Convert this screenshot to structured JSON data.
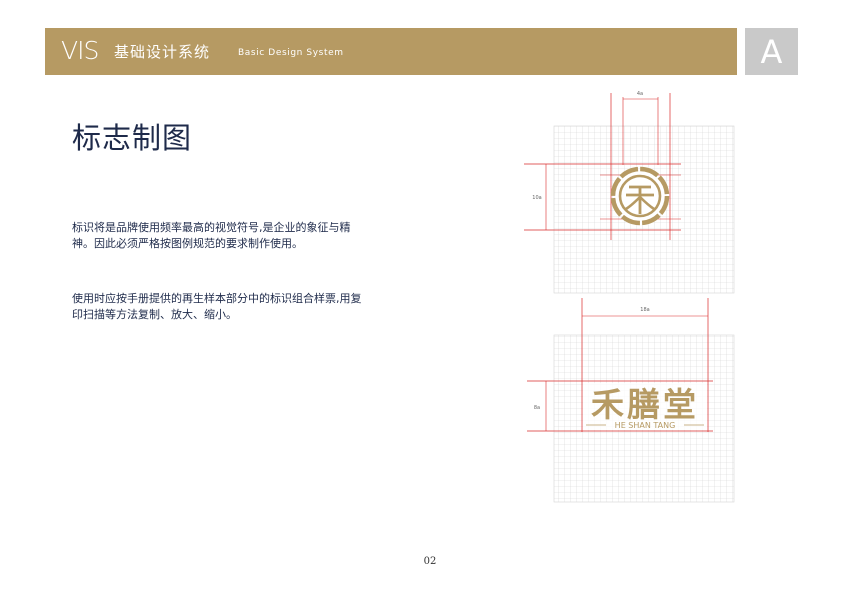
{
  "header": {
    "logo_text": "VIS",
    "title_cn": "基础设计系统",
    "title_en": "Basic Design System",
    "section_letter": "A",
    "bar_color": "#b69a63",
    "section_color": "#c9c9c9"
  },
  "page": {
    "title": "标志制图",
    "paragraph1": "标识将是品牌使用频率最高的视觉符号,是企业的象征与精神。因此必须严格按图例规范的要求制作使用。",
    "paragraph2": "使用时应按手册提供的再生样本部分中的标识组合样票,用复印扫描等方法复制、放大、缩小。",
    "page_number": "02"
  },
  "figures": {
    "emblem_grid": {
      "top_dimension": "4a",
      "side_dimension": "10a"
    },
    "wordmark_grid": {
      "top_dimension": "18a",
      "side_dimension": "8a",
      "brand_cn": "禾膳堂",
      "brand_en": "HE SHAN TANG"
    },
    "colors": {
      "brand_gold": "#b69a63",
      "guide_red": "#d92a2a",
      "grid_gray": "#d4d4d4"
    }
  }
}
